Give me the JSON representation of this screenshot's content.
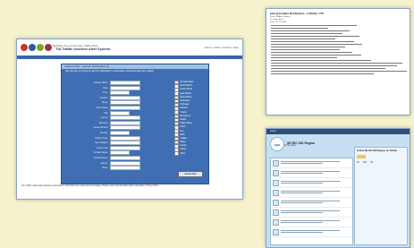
{
  "main": {
    "brand_title": "TIA Traffic Incident Alert System",
    "brand_subtitle": "Berkeley Ave Community Traffic Alerts",
    "top_links": "Home | Alerts | Submit | Help",
    "form_title": "Incident Alert - System Notification (1)",
    "form_intro": "Use this form to submit an alert for distribution to subscribers. Required fields are marked.",
    "form_rows": [
      {
        "label": "Incident Name:"
      },
      {
        "label": "Date:"
      },
      {
        "label": "Time:"
      },
      {
        "label": "Location:"
      },
      {
        "label": "Street:"
      },
      {
        "label": "Cross Street:"
      },
      {
        "label": "City:"
      },
      {
        "label": "County:"
      },
      {
        "label": "Direction:"
      },
      {
        "label": "Lanes Affected:"
      },
      {
        "label": "Severity:"
      },
      {
        "label": "Incident Type:"
      },
      {
        "label": "Est. Duration:"
      },
      {
        "label": "Detour Info:"
      },
      {
        "label": "Contact Name:"
      },
      {
        "label": "Contact Phone:"
      },
      {
        "label": "Agency:"
      },
      {
        "label": "Notes:"
      }
    ],
    "checkbox_labels": [
      "All subscribers",
      "North District",
      "South District",
      "East District",
      "West District",
      "Downtown",
      "Highways",
      "Schools",
      "Transit",
      "Emergency",
      "Media",
      "Public Works",
      "Police",
      "Fire",
      "EMS",
      "Utilities",
      "Parks",
      "Library",
      "Admin",
      "Other"
    ],
    "submit_label": "Submit Alert",
    "footer_text": "The Traffic Incident Alert System sends alerts to subscribers by email and text message. Please review all information before submitting.",
    "footer_link": "Privacy Policy"
  },
  "email": {
    "subject": "[Alert] Incident Notification - 2 (2010), 1:55",
    "meta_lines": [
      "From: TIA Alert System",
      "To: subscribers",
      "Date: Tue 10 2010"
    ]
  },
  "social": {
    "top_bar": "twitter",
    "avatar_text": "cps",
    "profile_name": "SE R/C ISD Region",
    "profile_handle": "@TIA_alerts",
    "side_title": "Follow SE R/C ISD Region on Twitter",
    "stats": [
      "21",
      "154",
      "61"
    ]
  }
}
